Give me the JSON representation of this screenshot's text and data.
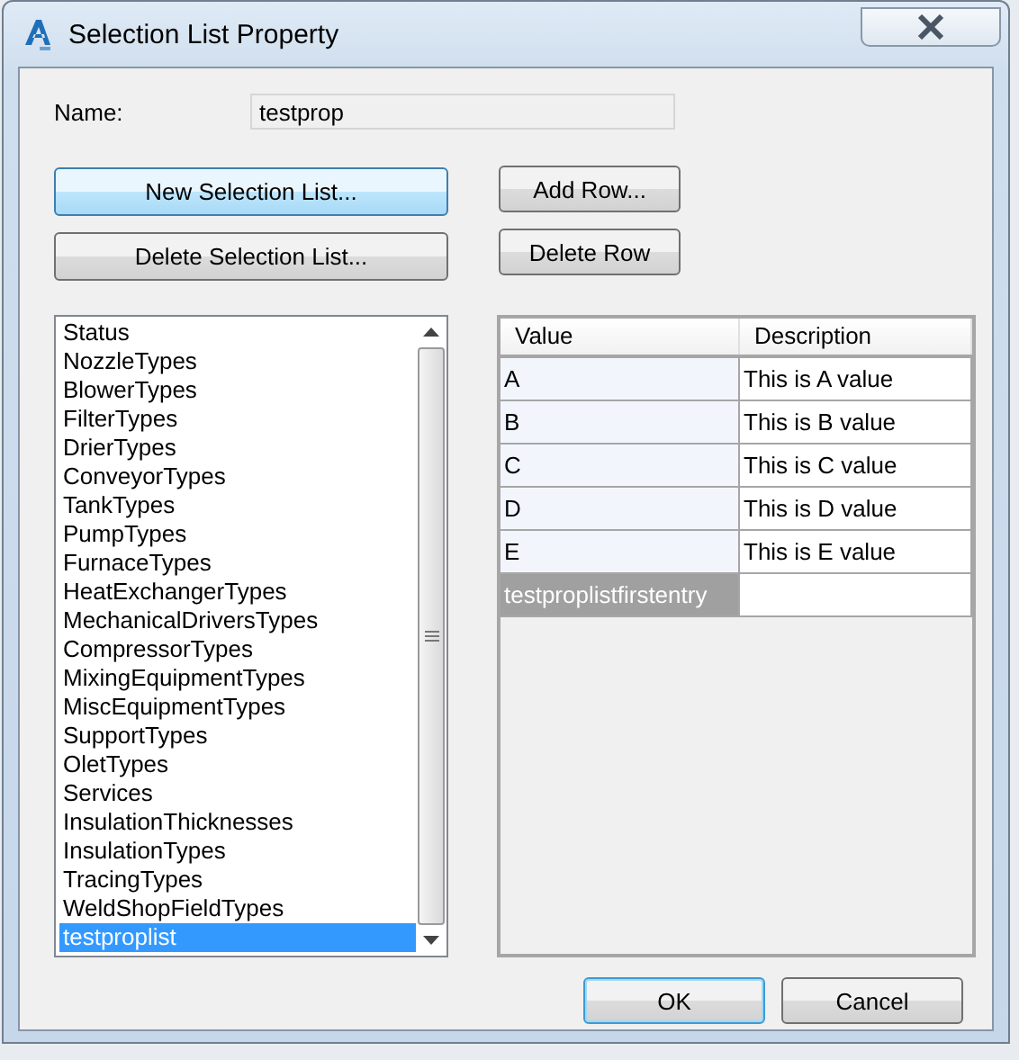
{
  "window": {
    "title": "Selection List Property"
  },
  "name_field": {
    "label": "Name:",
    "value": "testprop"
  },
  "buttons": [
    {
      "label": "New Selection List...",
      "hot": true
    },
    {
      "label": "Delete Selection List...",
      "hot": false
    }
  ],
  "row_buttons": [
    {
      "label": "Add Row...",
      "hot": false
    },
    {
      "label": "Delete Row",
      "hot": false
    }
  ],
  "selection_lists": [
    {
      "label": "Status",
      "selected": false
    },
    {
      "label": "NozzleTypes",
      "selected": false
    },
    {
      "label": "BlowerTypes",
      "selected": false
    },
    {
      "label": "FilterTypes",
      "selected": false
    },
    {
      "label": "DrierTypes",
      "selected": false
    },
    {
      "label": "ConveyorTypes",
      "selected": false
    },
    {
      "label": "TankTypes",
      "selected": false
    },
    {
      "label": "PumpTypes",
      "selected": false
    },
    {
      "label": "FurnaceTypes",
      "selected": false
    },
    {
      "label": "HeatExchangerTypes",
      "selected": false
    },
    {
      "label": "MechanicalDriversTypes",
      "selected": false
    },
    {
      "label": "CompressorTypes",
      "selected": false
    },
    {
      "label": "MixingEquipmentTypes",
      "selected": false
    },
    {
      "label": "MiscEquipmentTypes",
      "selected": false
    },
    {
      "label": "SupportTypes",
      "selected": false
    },
    {
      "label": "OletTypes",
      "selected": false
    },
    {
      "label": "Services",
      "selected": false
    },
    {
      "label": "InsulationThicknesses",
      "selected": false
    },
    {
      "label": "InsulationTypes",
      "selected": false
    },
    {
      "label": "TracingTypes",
      "selected": false
    },
    {
      "label": "WeldShopFieldTypes",
      "selected": false
    },
    {
      "label": "testproplist",
      "selected": true
    }
  ],
  "table": {
    "columns": [
      "Value",
      "Description"
    ],
    "rows": [
      {
        "value": "A",
        "description": "This is A value",
        "selected": false
      },
      {
        "value": "B",
        "description": "This is B value",
        "selected": false
      },
      {
        "value": "C",
        "description": "This is C value",
        "selected": false
      },
      {
        "value": "D",
        "description": "This is D value",
        "selected": false
      },
      {
        "value": "E",
        "description": "This is E value",
        "selected": false
      },
      {
        "value": "testproplistfirstentry",
        "selected": true
      }
    ]
  },
  "dialog_buttons": [
    {
      "label": "OK",
      "default": true
    },
    {
      "label": "Cancel",
      "default": false
    }
  ]
}
